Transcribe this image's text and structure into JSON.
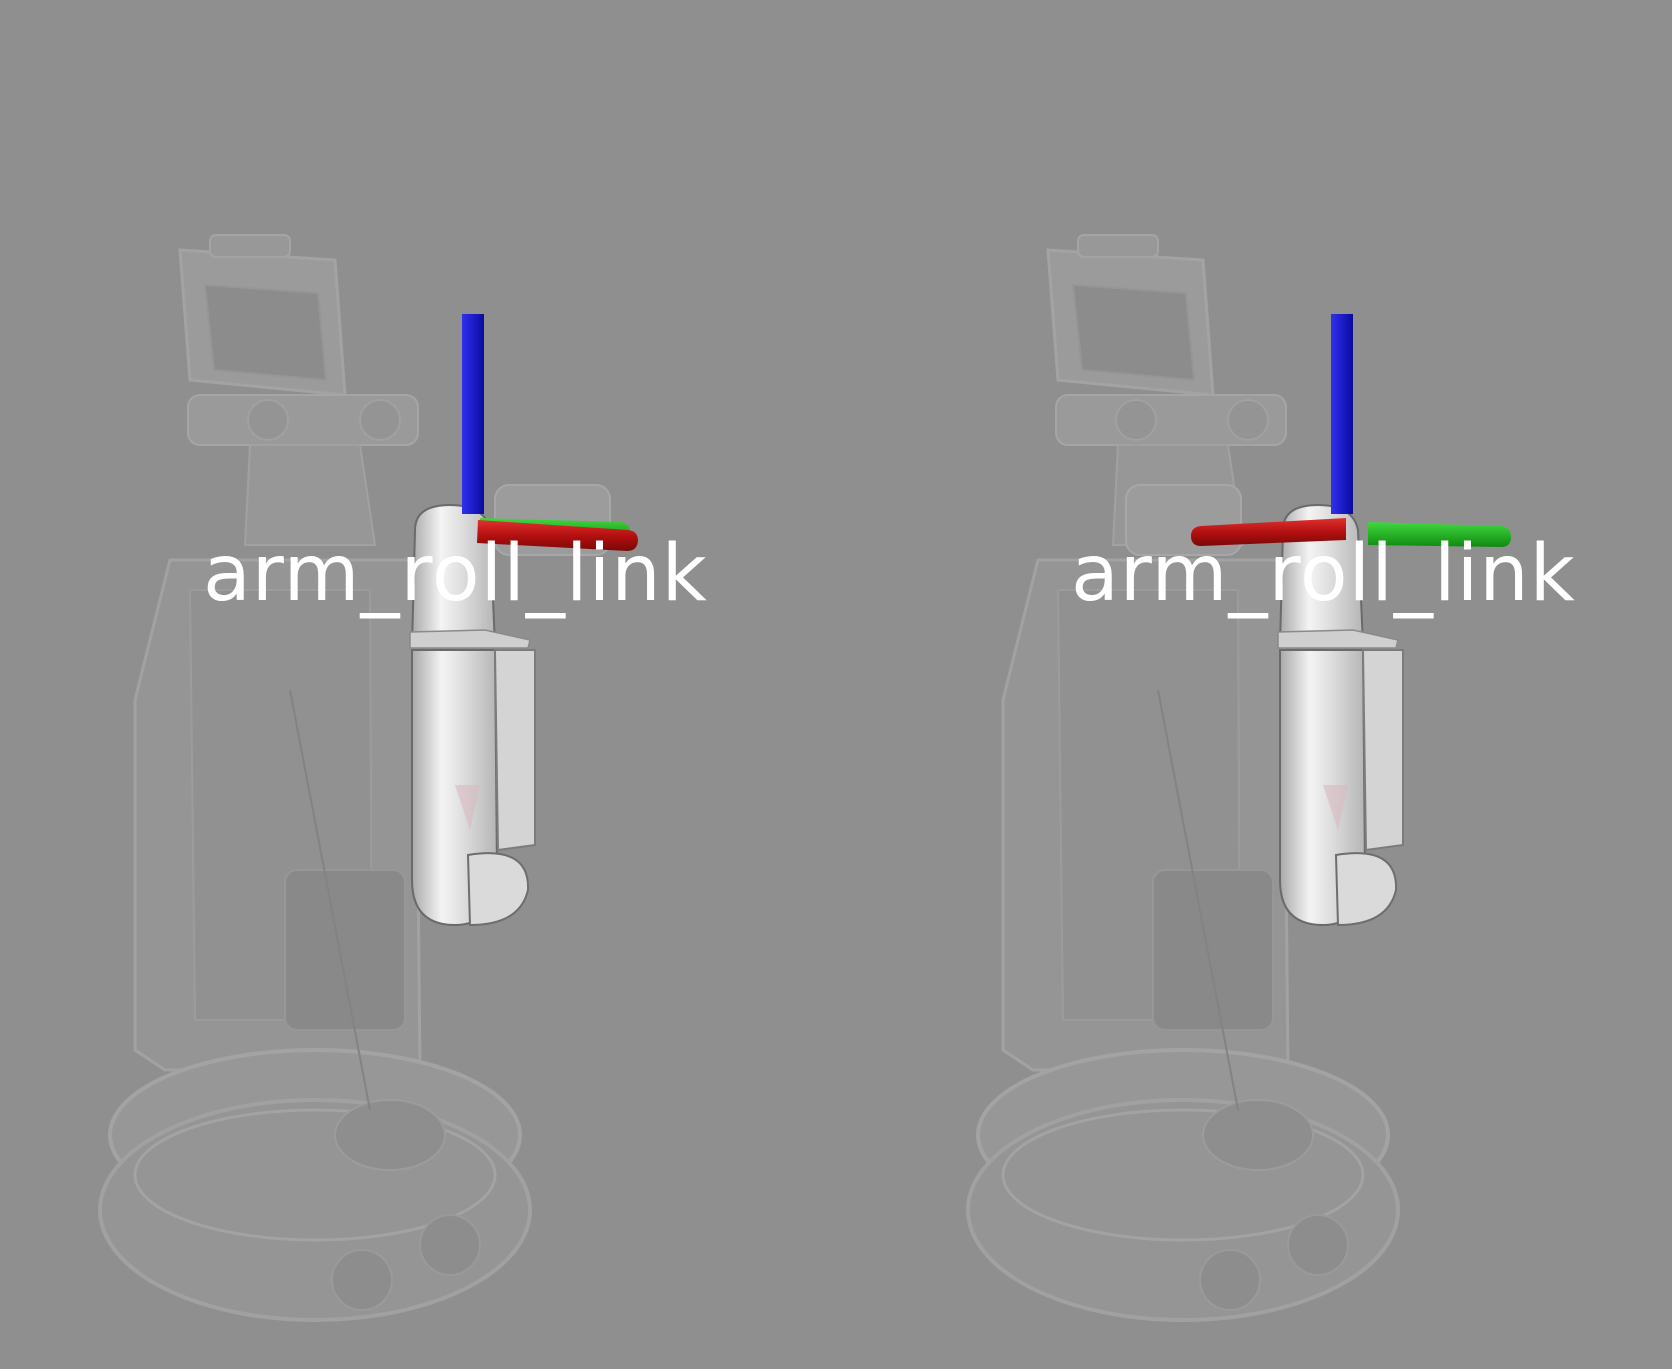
{
  "views": [
    {
      "id": "left",
      "frame_label": "arm_roll_link",
      "axes": {
        "x_axis": "pointing-right",
        "y_axis": "pointing-right-behind",
        "z_axis": "pointing-up"
      }
    },
    {
      "id": "right",
      "frame_label": "arm_roll_link",
      "axes": {
        "x_axis": "pointing-left",
        "y_axis": "pointing-right",
        "z_axis": "pointing-up"
      }
    }
  ],
  "colors": {
    "background": "#8f8f8f",
    "x_axis": "#c81414",
    "y_axis": "#18b818",
    "z_axis": "#1414d8",
    "ghost_body": "#b8b8b8",
    "arm_link": "#e8e8e8",
    "label": "#ffffff"
  }
}
